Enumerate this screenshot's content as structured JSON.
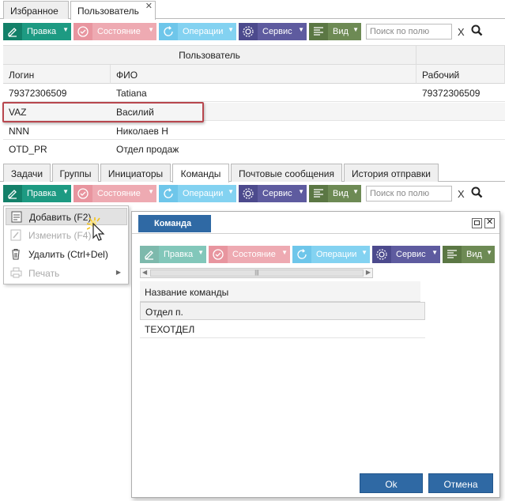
{
  "top_tabs": [
    {
      "label": "Избранное"
    },
    {
      "label": "Пользователь"
    }
  ],
  "top_tab_close": "✕",
  "toolbar": {
    "edit_label": "Правка",
    "state_label": "Состояние",
    "ops_label": "Операции",
    "service_label": "Сервис",
    "view_label": "Вид",
    "search_placeholder": "Поиск по полю",
    "clear_label": "X"
  },
  "users_grid": {
    "group_header": "Пользователь",
    "columns": [
      "Логин",
      "ФИО",
      "Рабочий"
    ],
    "rows": [
      {
        "login": "79372306509",
        "fio": "Tatiana",
        "work": "79372306509"
      },
      {
        "login": "VAZ",
        "fio": "Василий",
        "work": ""
      },
      {
        "login": "NNN",
        "fio": "Николаев Н",
        "work": ""
      },
      {
        "login": "OTD_PR",
        "fio": "Отдел продаж",
        "work": ""
      }
    ],
    "highlighted_row": "VAZ"
  },
  "sub_tabs": [
    {
      "label": "Задачи"
    },
    {
      "label": "Группы"
    },
    {
      "label": "Инициаторы"
    },
    {
      "label": "Команды"
    },
    {
      "label": "Почтовые сообщения"
    },
    {
      "label": "История отправки"
    }
  ],
  "active_sub_tab": "Команды",
  "context_menu": {
    "items": [
      {
        "label": "Добавить (F2)",
        "icon": "add-doc-icon",
        "enabled": true
      },
      {
        "label": "Изменить (F4)",
        "icon": "pencil-icon",
        "enabled": false
      },
      {
        "label": "Удалить (Ctrl+Del)",
        "icon": "trash-icon",
        "enabled": true
      },
      {
        "label": "Печать",
        "icon": "printer-icon",
        "enabled": false
      }
    ]
  },
  "dialog": {
    "title": "Команда",
    "toolbar": {
      "edit_label": "Правка",
      "state_label": "Состояние",
      "ops_label": "Операции",
      "service_label": "Сервис",
      "view_label": "Вид"
    },
    "column_header": "Название команды",
    "rows": [
      "Отдел п.",
      "ТЕХОТДЕЛ"
    ],
    "ok_label": "Ok",
    "cancel_label": "Отмена"
  },
  "colors": {
    "edit": "#1d9a82",
    "state": "#eeaab2",
    "ops": "#83d2f1",
    "service": "#5e5b9f",
    "view": "#6d8a54",
    "dialog_accent": "#2f69a4",
    "selection_frame": "#b8474e"
  }
}
